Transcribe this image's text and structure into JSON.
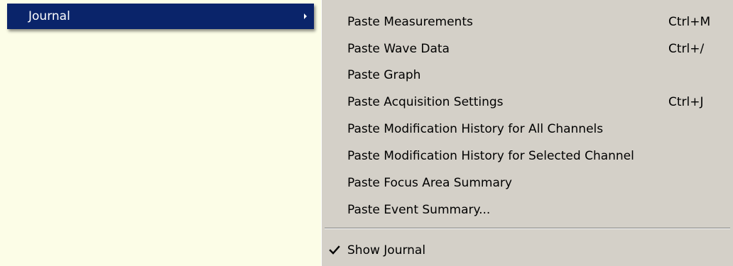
{
  "parent_menu": {
    "item_label": "Journal",
    "background": "#fcfde7",
    "highlight": "#0a246a",
    "arrow_icon": "submenu-arrow-icon"
  },
  "submenu": {
    "background": "#d4d0c8",
    "items": [
      {
        "label": "Paste Measurements",
        "shortcut": "Ctrl+M"
      },
      {
        "label": "Paste Wave Data",
        "shortcut": "Ctrl+/"
      },
      {
        "label": "Paste Graph",
        "shortcut": ""
      },
      {
        "label": "Paste Acquisition Settings",
        "shortcut": "Ctrl+J"
      },
      {
        "label": "Paste Modification History for All Channels",
        "shortcut": ""
      },
      {
        "label": "Paste Modification History for Selected Channel",
        "shortcut": ""
      },
      {
        "label": "Paste Focus Area Summary",
        "shortcut": ""
      },
      {
        "label": "Paste Event Summary...",
        "shortcut": ""
      }
    ],
    "toggle_item": {
      "label": "Show Journal",
      "checked": true,
      "icon": "checkmark-icon"
    }
  }
}
